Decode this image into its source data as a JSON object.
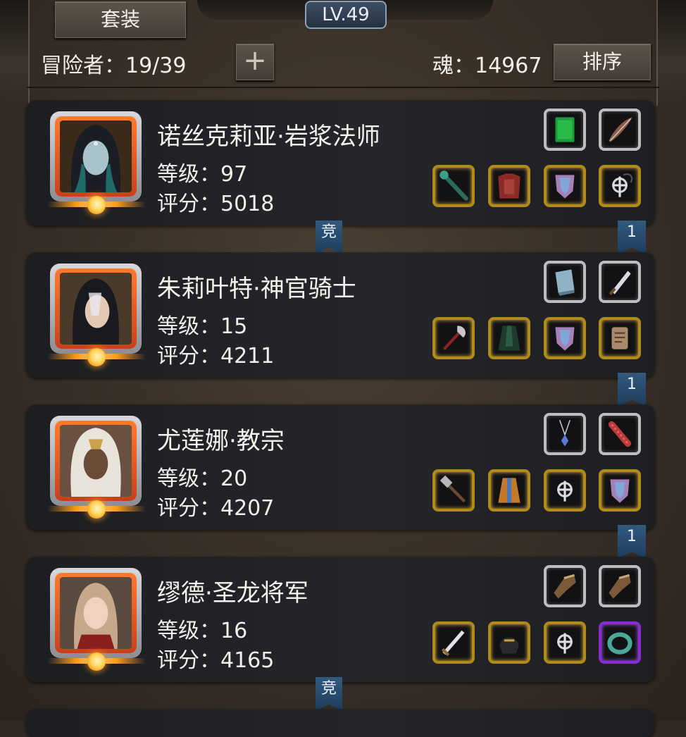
{
  "header": {
    "suit_button": "套装",
    "level_badge": "LV.49",
    "adventurer_label": "冒险者：19/39",
    "add_button": "+",
    "soul_label": "魂：14967",
    "sort_button": "排序"
  },
  "heroes": [
    {
      "name": "诺丝克莉亚·岩浆法师",
      "level": "等级：97",
      "score": "评分：5018",
      "top_slots": [
        {
          "icon": "green-tome-icon",
          "frame": "grey"
        },
        {
          "icon": "feather-quill-icon",
          "frame": "grey"
        }
      ],
      "bottom_slots": [
        {
          "icon": "green-staff-icon",
          "frame": "gold"
        },
        {
          "icon": "red-armor-icon",
          "frame": "gold"
        },
        {
          "icon": "crystal-shield-icon",
          "frame": "gold"
        },
        {
          "icon": "cross-amulet-icon",
          "frame": "gold"
        }
      ]
    },
    {
      "name": "朱莉叶特·神官骑士",
      "level": "等级：15",
      "score": "评分：4211",
      "top_slots": [
        {
          "icon": "blue-book-icon",
          "frame": "grey"
        },
        {
          "icon": "dagger-icon",
          "frame": "grey"
        }
      ],
      "bottom_slots": [
        {
          "icon": "axe-icon",
          "frame": "gold"
        },
        {
          "icon": "dark-cloak-icon",
          "frame": "gold"
        },
        {
          "icon": "crystal-shield-icon",
          "frame": "gold"
        },
        {
          "icon": "scroll-icon",
          "frame": "gold"
        }
      ]
    },
    {
      "name": "尤莲娜·教宗",
      "level": "等级：20",
      "score": "评分：4207",
      "top_slots": [
        {
          "icon": "pendant-icon",
          "frame": "grey"
        },
        {
          "icon": "red-relic-icon",
          "frame": "grey"
        }
      ],
      "bottom_slots": [
        {
          "icon": "hammer-icon",
          "frame": "gold"
        },
        {
          "icon": "robe-icon",
          "frame": "gold"
        },
        {
          "icon": "cross-amulet-icon",
          "frame": "gold"
        },
        {
          "icon": "crystal-shield-icon",
          "frame": "gold"
        }
      ]
    },
    {
      "name": "缪德·圣龙将军",
      "level": "等级：16",
      "score": "评分：4165",
      "top_slots": [
        {
          "icon": "gauntlet-icon",
          "frame": "grey"
        },
        {
          "icon": "gauntlet-icon",
          "frame": "grey"
        }
      ],
      "bottom_slots": [
        {
          "icon": "sword-icon",
          "frame": "gold"
        },
        {
          "icon": "helmet-icon",
          "frame": "gold"
        },
        {
          "icon": "cross-amulet-icon",
          "frame": "gold"
        },
        {
          "icon": "green-ring-icon",
          "frame": "purple"
        }
      ]
    }
  ],
  "tags": {
    "competition": "竞",
    "rank_1": "1"
  },
  "colors": {
    "gold_frame": "#b28a1a",
    "grey_frame": "#bdbdc0",
    "purple_frame": "#8a2bd0",
    "tag_blue": "#2a4d72",
    "portrait_orange": "#ff7a2c"
  }
}
